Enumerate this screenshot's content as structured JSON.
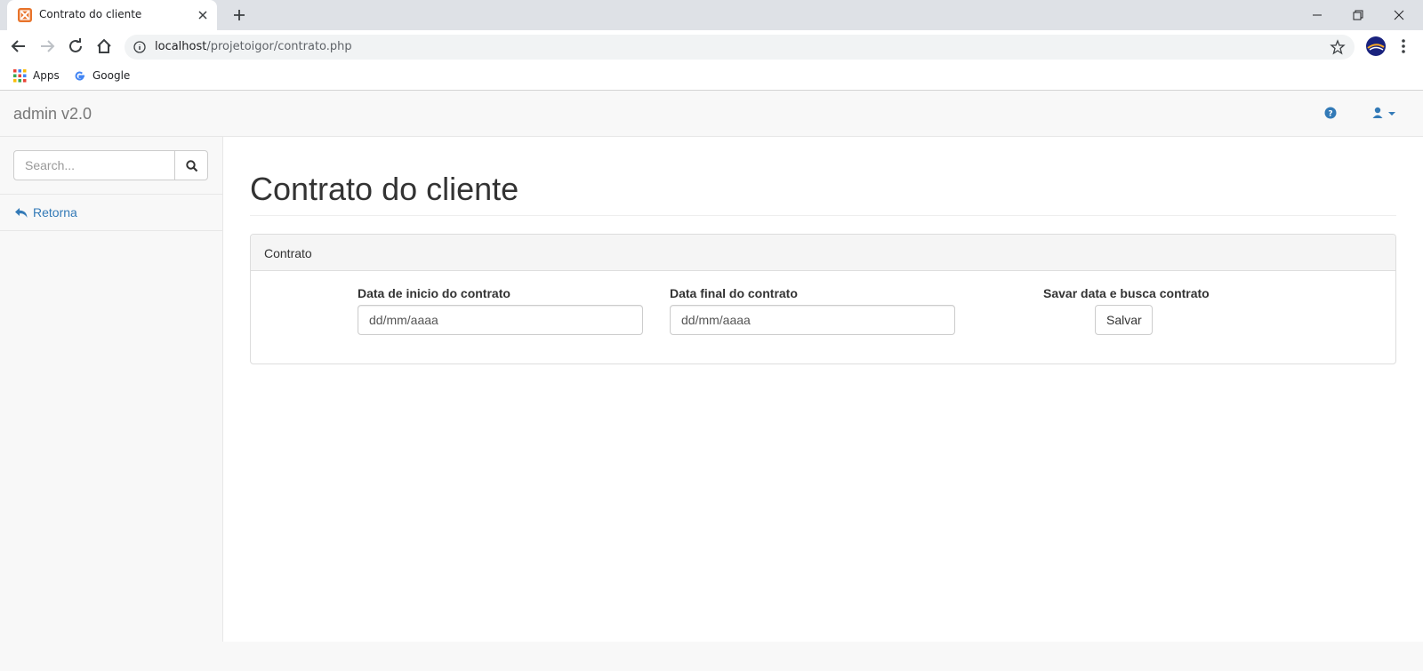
{
  "browser": {
    "tab_title": "Contrato do cliente",
    "url_host": "localhost",
    "url_path": "/projetoigor/contrato.php",
    "bookmarks": [
      {
        "label": "Apps",
        "icon": "apps-grid-icon"
      },
      {
        "label": "Google",
        "icon": "google-icon"
      }
    ]
  },
  "navbar": {
    "brand": "admin v2.0",
    "help_icon": "question-circle-icon",
    "user_icon": "user-icon"
  },
  "sidebar": {
    "search_placeholder": "Search...",
    "links": [
      {
        "label": "Retorna",
        "icon": "reply-icon"
      }
    ]
  },
  "main": {
    "title": "Contrato do cliente",
    "panel": {
      "heading": "Contrato",
      "start_label": "Data de inicio do contrato",
      "start_placeholder": "dd/mm/aaaa",
      "end_label": "Data final do contrato",
      "end_placeholder": "dd/mm/aaaa",
      "action_label": "Savar data e busca contrato",
      "save_button": "Salvar"
    }
  },
  "colors": {
    "link": "#337ab7",
    "favicon": "#e8732a",
    "chrome_tabbar": "#dee1e6"
  }
}
